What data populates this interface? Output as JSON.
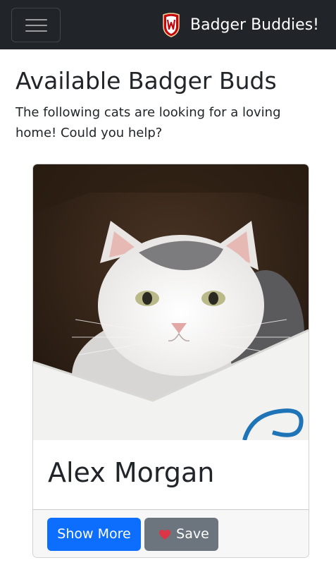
{
  "navbar": {
    "brand": "Badger Buddies!",
    "toggler_icon": "hamburger-menu-icon",
    "crest_icon": "uw-crest-icon",
    "background": "#212529"
  },
  "main": {
    "title": "Available Badger Buds",
    "intro": "The following cats are looking for a loving home! Could you help?"
  },
  "card": {
    "name": "Alex Morgan",
    "image_subject": "white and grey cat in a cardboard box",
    "buttons": {
      "show_more": "Show More",
      "save": "Save",
      "save_icon": "heart-icon"
    },
    "colors": {
      "primary": "#0d6efd",
      "secondary": "#6c757d",
      "heart": "#dc3545"
    }
  }
}
